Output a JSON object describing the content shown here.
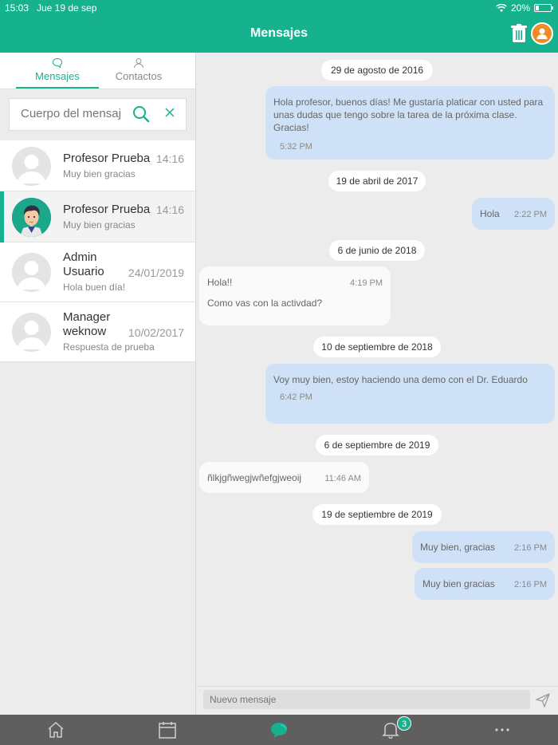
{
  "status_bar": {
    "time": "15:03",
    "date": "Jue 19 de sep",
    "battery": "20%",
    "battery_level": 0.2
  },
  "header": {
    "title": "Mensajes"
  },
  "tabs": [
    {
      "label": "Mensajes",
      "icon": "chat-bubble-icon",
      "active": true
    },
    {
      "label": "Contactos",
      "icon": "person-icon",
      "active": false
    }
  ],
  "search": {
    "placeholder": "Cuerpo del mensaje"
  },
  "conversations": [
    {
      "name": "Profesor Prueba",
      "time": "14:16",
      "preview": "Muy bien gracias"
    },
    {
      "name": "Profesor Prueba",
      "time": "14:16",
      "preview": "Muy bien gracias"
    },
    {
      "name": "Admin Usuario",
      "time": "24/01/2019",
      "preview": "Hola buen día!"
    },
    {
      "name": "Manager weknow",
      "time": "10/02/2017",
      "preview": "Respuesta de prueba"
    }
  ],
  "messages": [
    {
      "date": "29 de agosto de 2016"
    },
    {
      "text": "Hola profesor, buenos días! Me gustaría platicar con usted para unas dudas que tengo sobre la tarea de la próxima clase. Gracias!",
      "time": "5:32 PM"
    },
    {
      "date": "19 de abril de 2017"
    },
    {
      "text": "Hola",
      "time": "2:22 PM"
    },
    {
      "date": "6 de junio de 2018"
    },
    {
      "text_line1": "Hola!!",
      "text_line2": "Como vas con la activdad?",
      "time": "4:19 PM"
    },
    {
      "date": "10 de septiembre de 2018"
    },
    {
      "text": "Voy muy bien, estoy haciendo una demo con el Dr. Eduardo",
      "time": "6:42 PM"
    },
    {
      "date": "6 de septiembre de 2019"
    },
    {
      "text": "ñlkjgñwegjwñefgjweoij",
      "time": "11:46 AM"
    },
    {
      "date": "19 de septiembre de 2019"
    },
    {
      "text": "Muy bien, gracias",
      "time": "2:16 PM"
    },
    {
      "text": "Muy bien gracias",
      "time": "2:16 PM"
    }
  ],
  "composer": {
    "placeholder": "Nuevo mensaje"
  },
  "tabbar": {
    "notifications_badge": "3"
  }
}
